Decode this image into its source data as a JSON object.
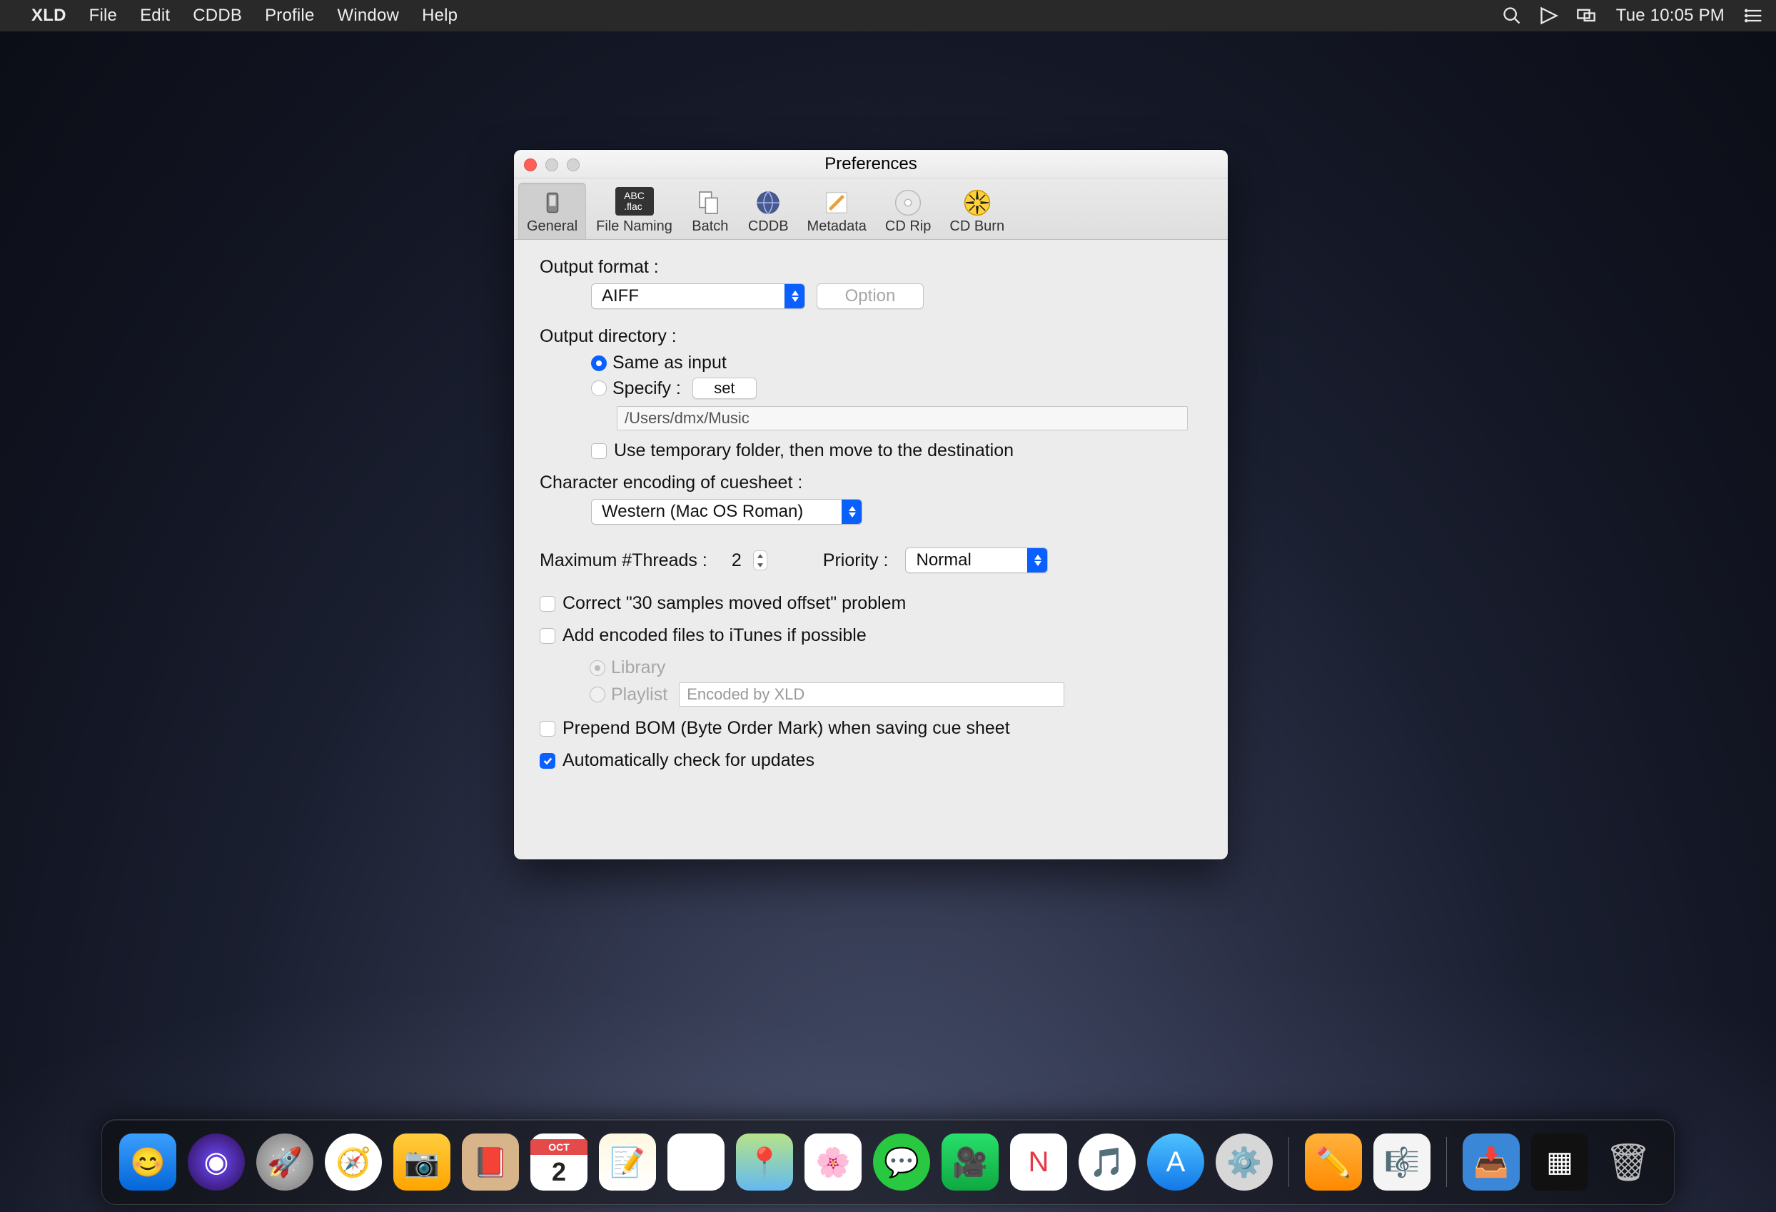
{
  "menubar": {
    "appname": "XLD",
    "items": [
      "File",
      "Edit",
      "CDDB",
      "Profile",
      "Window",
      "Help"
    ],
    "clock": "Tue 10:05 PM"
  },
  "dock": {
    "calendar_month": "OCT",
    "calendar_day": "2"
  },
  "window": {
    "title": "Preferences",
    "tabs": [
      {
        "label": "General"
      },
      {
        "label": "File Naming"
      },
      {
        "label": "Batch"
      },
      {
        "label": "CDDB"
      },
      {
        "label": "Metadata"
      },
      {
        "label": "CD Rip"
      },
      {
        "label": "CD Burn"
      }
    ],
    "labels": {
      "output_format": "Output format :",
      "option_btn": "Option",
      "output_directory": "Output directory :",
      "same_as_input": "Same as input",
      "specify": "Specify :",
      "set_btn": "set",
      "use_temp_folder": "Use temporary folder, then move to the destination",
      "char_encoding": "Character encoding of cuesheet :",
      "max_threads": "Maximum #Threads :",
      "priority": "Priority :",
      "correct_offset": "Correct \"30 samples moved offset\" problem",
      "add_to_itunes": "Add encoded files to iTunes if possible",
      "library": "Library",
      "playlist": "Playlist",
      "prepend_bom": "Prepend BOM (Byte Order Mark) when saving cue sheet",
      "auto_updates": "Automatically check for updates"
    },
    "values": {
      "output_format": "AIFF",
      "output_path": "/Users/dmx/Music",
      "encoding": "Western (Mac OS Roman)",
      "threads": "2",
      "priority": "Normal",
      "playlist_name": "Encoded by XLD"
    }
  }
}
